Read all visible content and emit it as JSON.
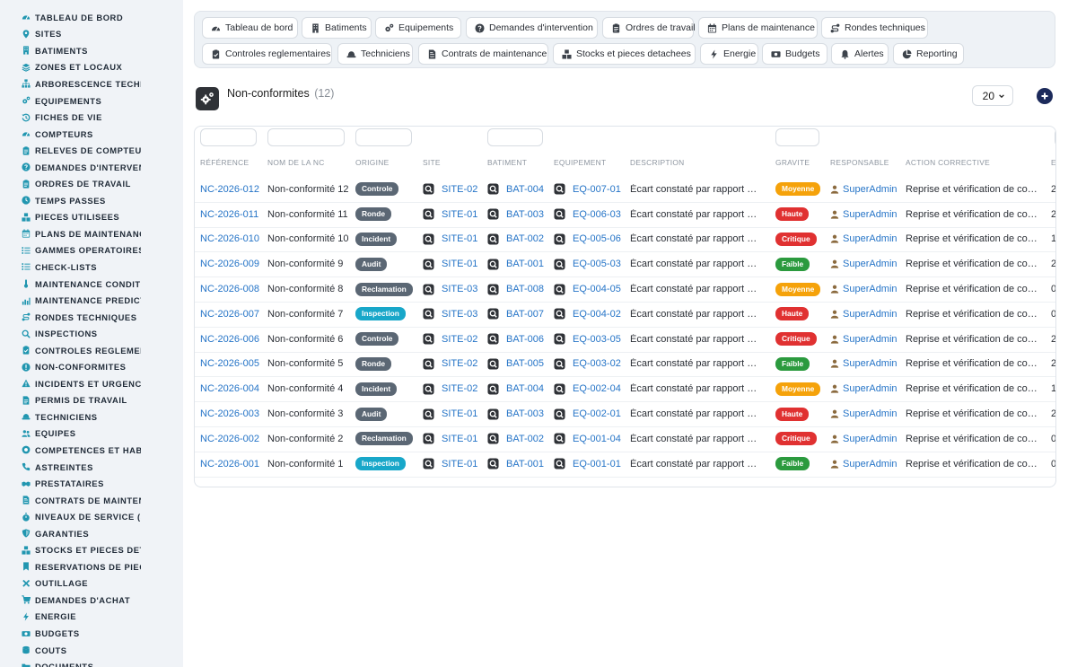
{
  "sidebar": {
    "items": [
      {
        "label": "TABLEAU DE BORD",
        "icon": "gauge-icon"
      },
      {
        "label": "SITES",
        "icon": "map-pin-icon"
      },
      {
        "label": "BATIMENTS",
        "icon": "building-icon"
      },
      {
        "label": "ZONES ET LOCAUX",
        "icon": "layers-icon"
      },
      {
        "label": "ARBORESCENCE TECHNI",
        "icon": "sitemap-icon"
      },
      {
        "label": "EQUIPEMENTS",
        "icon": "gears-icon"
      },
      {
        "label": "FICHES DE VIE",
        "icon": "history-icon"
      },
      {
        "label": "COMPTEURS",
        "icon": "gauge-icon"
      },
      {
        "label": "RELEVES DE COMPTEURS",
        "icon": "clipboard-icon"
      },
      {
        "label": "DEMANDES D'INTERVENT",
        "icon": "question-icon"
      },
      {
        "label": "ORDRES DE TRAVAIL",
        "icon": "clipboard-icon"
      },
      {
        "label": "TEMPS PASSES",
        "icon": "clock-icon"
      },
      {
        "label": "PIECES UTILISEES",
        "icon": "boxes-icon"
      },
      {
        "label": "PLANS DE MAINTENANCE",
        "icon": "calendar-icon"
      },
      {
        "label": "GAMMES OPERATOIRES",
        "icon": "list-icon"
      },
      {
        "label": "CHECK-LISTS",
        "icon": "list-icon"
      },
      {
        "label": "MAINTENANCE CONDITIO",
        "icon": "thermometer-icon"
      },
      {
        "label": "MAINTENANCE PREDICTI",
        "icon": "chart-icon"
      },
      {
        "label": "RONDES TECHNIQUES",
        "icon": "route-icon"
      },
      {
        "label": "INSPECTIONS",
        "icon": "search-icon"
      },
      {
        "label": "CONTROLES REGLEMENT",
        "icon": "clipboard-check-icon"
      },
      {
        "label": "NON-CONFORMITES",
        "icon": "alert-circle-icon"
      },
      {
        "label": "INCIDENTS ET URGENCES",
        "icon": "warning-icon"
      },
      {
        "label": "PERMIS DE TRAVAIL",
        "icon": "file-icon"
      },
      {
        "label": "TECHNICIENS",
        "icon": "hard-hat-icon"
      },
      {
        "label": "EQUIPES",
        "icon": "users-icon"
      },
      {
        "label": "COMPETENCES ET HABIL",
        "icon": "certificate-icon"
      },
      {
        "label": "ASTREINTES",
        "icon": "phone-icon"
      },
      {
        "label": "PRESTATAIRES",
        "icon": "handshake-icon"
      },
      {
        "label": "CONTRATS DE MAINTENA",
        "icon": "file-contract-icon"
      },
      {
        "label": "NIVEAUX DE SERVICE (SL",
        "icon": "stopwatch-icon"
      },
      {
        "label": "GARANTIES",
        "icon": "shield-icon"
      },
      {
        "label": "STOCKS ET PIECES DETA",
        "icon": "boxes-icon"
      },
      {
        "label": "RESERVATIONS DE PIECE",
        "icon": "bookmark-icon"
      },
      {
        "label": "OUTILLAGE",
        "icon": "tools-icon"
      },
      {
        "label": "DEMANDES D'ACHAT",
        "icon": "cart-icon"
      },
      {
        "label": "ENERGIE",
        "icon": "bolt-icon"
      },
      {
        "label": "BUDGETS",
        "icon": "money-icon"
      },
      {
        "label": "COUTS",
        "icon": "coins-icon"
      },
      {
        "label": "DOCUMENTS",
        "icon": "folder-icon"
      }
    ]
  },
  "topnav": {
    "items": [
      {
        "label": "Tableau de bord",
        "icon": "gauge-icon"
      },
      {
        "label": "Batiments",
        "icon": "building-icon"
      },
      {
        "label": "Equipements",
        "icon": "gears-icon"
      },
      {
        "label": "Demandes d'intervention",
        "icon": "question-icon"
      },
      {
        "label": "Ordres de travail",
        "icon": "clipboard-icon"
      },
      {
        "label": "Plans de maintenance",
        "icon": "calendar-icon"
      },
      {
        "label": "Rondes techniques",
        "icon": "route-icon"
      },
      {
        "label": "Controles reglementaires",
        "icon": "clipboard-check-icon"
      },
      {
        "label": "Techniciens",
        "icon": "hard-hat-icon"
      },
      {
        "label": "Contrats de maintenance",
        "icon": "file-contract-icon"
      },
      {
        "label": "Stocks et pieces detachees",
        "icon": "boxes-icon"
      },
      {
        "label": "Energie",
        "icon": "bolt-icon"
      },
      {
        "label": "Budgets",
        "icon": "money-icon"
      },
      {
        "label": "Alertes",
        "icon": "bell-icon"
      },
      {
        "label": "Reporting",
        "icon": "pie-icon"
      }
    ]
  },
  "page": {
    "title": "Non-conformites",
    "count": "(12)",
    "per_page": "20",
    "add_icon": "plus-circle-icon",
    "title_icon": "gears-icon"
  },
  "table": {
    "columns": [
      "RÉFÉRENCE",
      "NOM DE LA NC",
      "ORIGINE",
      "SITE",
      "BATIMENT",
      "EQUIPEMENT",
      "DESCRIPTION",
      "GRAVITE",
      "RESPONSABLE",
      "ACTION CORRECTIVE",
      "E"
    ],
    "origin_colors": {
      "Controle": "#5b6774",
      "Ronde": "#5b6774",
      "Incident": "#5b6774",
      "Audit": "#5b6774",
      "Reclamation": "#5b6774",
      "Inspection": "#18a7c9"
    },
    "gravity_colors": {
      "Moyenne": "#f5a20a",
      "Haute": "#e03131",
      "Critique": "#e03131",
      "Faible": "#2b9a3e"
    },
    "rows": [
      {
        "ref": "NC-2026-012",
        "name": "Non-conformité 12",
        "origin": "Controle",
        "site": "SITE-02",
        "bat": "BAT-004",
        "eq": "EQ-007-01",
        "desc": "Écart constaté par rapport au référentiel",
        "grav": "Moyenne",
        "resp": "SuperAdmin",
        "action": "Reprise et vérification de conformité",
        "e": "2"
      },
      {
        "ref": "NC-2026-011",
        "name": "Non-conformité 11",
        "origin": "Ronde",
        "site": "SITE-01",
        "bat": "BAT-003",
        "eq": "EQ-006-03",
        "desc": "Écart constaté par rapport au référentiel",
        "grav": "Haute",
        "resp": "SuperAdmin",
        "action": "Reprise et vérification de conformité",
        "e": "2"
      },
      {
        "ref": "NC-2026-010",
        "name": "Non-conformité 10",
        "origin": "Incident",
        "site": "SITE-01",
        "bat": "BAT-002",
        "eq": "EQ-005-06",
        "desc": "Écart constaté par rapport au référentiel",
        "grav": "Critique",
        "resp": "SuperAdmin",
        "action": "Reprise et vérification de conformité",
        "e": "1"
      },
      {
        "ref": "NC-2026-009",
        "name": "Non-conformité 9",
        "origin": "Audit",
        "site": "SITE-01",
        "bat": "BAT-001",
        "eq": "EQ-005-03",
        "desc": "Écart constaté par rapport au référentiel",
        "grav": "Faible",
        "resp": "SuperAdmin",
        "action": "Reprise et vérification de conformité",
        "e": "2"
      },
      {
        "ref": "NC-2026-008",
        "name": "Non-conformité 8",
        "origin": "Reclamation",
        "site": "SITE-03",
        "bat": "BAT-008",
        "eq": "EQ-004-05",
        "desc": "Écart constaté par rapport au référentiel",
        "grav": "Moyenne",
        "resp": "SuperAdmin",
        "action": "Reprise et vérification de conformité",
        "e": "0"
      },
      {
        "ref": "NC-2026-007",
        "name": "Non-conformité 7",
        "origin": "Inspection",
        "site": "SITE-03",
        "bat": "BAT-007",
        "eq": "EQ-004-02",
        "desc": "Écart constaté par rapport au référentiel",
        "grav": "Haute",
        "resp": "SuperAdmin",
        "action": "Reprise et vérification de conformité",
        "e": "0"
      },
      {
        "ref": "NC-2026-006",
        "name": "Non-conformité 6",
        "origin": "Controle",
        "site": "SITE-02",
        "bat": "BAT-006",
        "eq": "EQ-003-05",
        "desc": "Écart constaté par rapport au référentiel",
        "grav": "Critique",
        "resp": "SuperAdmin",
        "action": "Reprise et vérification de conformité",
        "e": "2"
      },
      {
        "ref": "NC-2026-005",
        "name": "Non-conformité 5",
        "origin": "Ronde",
        "site": "SITE-02",
        "bat": "BAT-005",
        "eq": "EQ-003-02",
        "desc": "Écart constaté par rapport au référentiel",
        "grav": "Faible",
        "resp": "SuperAdmin",
        "action": "Reprise et vérification de conformité",
        "e": "2"
      },
      {
        "ref": "NC-2026-004",
        "name": "Non-conformité 4",
        "origin": "Incident",
        "site": "SITE-02",
        "bat": "BAT-004",
        "eq": "EQ-002-04",
        "desc": "Écart constaté par rapport au référentiel",
        "grav": "Moyenne",
        "resp": "SuperAdmin",
        "action": "Reprise et vérification de conformité",
        "e": "1"
      },
      {
        "ref": "NC-2026-003",
        "name": "Non-conformité 3",
        "origin": "Audit",
        "site": "SITE-01",
        "bat": "BAT-003",
        "eq": "EQ-002-01",
        "desc": "Écart constaté par rapport au référentiel",
        "grav": "Haute",
        "resp": "SuperAdmin",
        "action": "Reprise et vérification de conformité",
        "e": "2"
      },
      {
        "ref": "NC-2026-002",
        "name": "Non-conformité 2",
        "origin": "Reclamation",
        "site": "SITE-01",
        "bat": "BAT-002",
        "eq": "EQ-001-04",
        "desc": "Écart constaté par rapport au référentiel",
        "grav": "Critique",
        "resp": "SuperAdmin",
        "action": "Reprise et vérification de conformité",
        "e": "0"
      },
      {
        "ref": "NC-2026-001",
        "name": "Non-conformité 1",
        "origin": "Inspection",
        "site": "SITE-01",
        "bat": "BAT-001",
        "eq": "EQ-001-01",
        "desc": "Écart constaté par rapport au référentiel",
        "grav": "Faible",
        "resp": "SuperAdmin",
        "action": "Reprise et vérification de conformité",
        "e": "0"
      }
    ]
  },
  "colors": {
    "sidebar_icon": "#2196b0",
    "link": "#2574c7",
    "primary_dark": "#1c2a5b"
  }
}
